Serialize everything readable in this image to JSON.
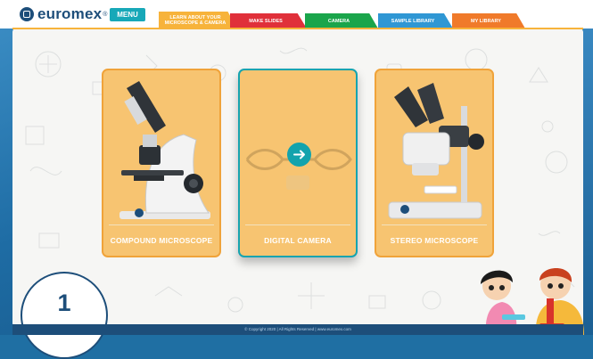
{
  "header": {
    "brand": "euromex",
    "brand_mark": "®",
    "menu_label": "MENU",
    "tabs": [
      {
        "label": "LEARN ABOUT YOUR MICROSCOPE & CAMERA",
        "color": "#f7b33b"
      },
      {
        "label": "MAKE SLIDES",
        "color": "#e0303a"
      },
      {
        "label": "CAMERA",
        "color": "#1aa54b"
      },
      {
        "label": "SAMPLE LIBRARY",
        "color": "#2f97d4"
      },
      {
        "label": "MY LIBRARY",
        "color": "#f07a2a"
      }
    ]
  },
  "cards": [
    {
      "label": "COMPOUND MICROSCOPE",
      "icon": "compound-microscope-image"
    },
    {
      "label": "DIGITAL CAMERA",
      "icon": "arrow-right-icon"
    },
    {
      "label": "STEREO MICROSCOPE",
      "icon": "stereo-microscope-image"
    }
  ],
  "step_number": "1",
  "footer": {
    "text": "© Copyright 2020  |  All Rights Reserved  |  www.euromex.com"
  },
  "colors": {
    "brand": "#1d4e7a",
    "accent": "#13a3ad",
    "card_fill": "#f7c471",
    "card_border": "#f0a33a"
  }
}
